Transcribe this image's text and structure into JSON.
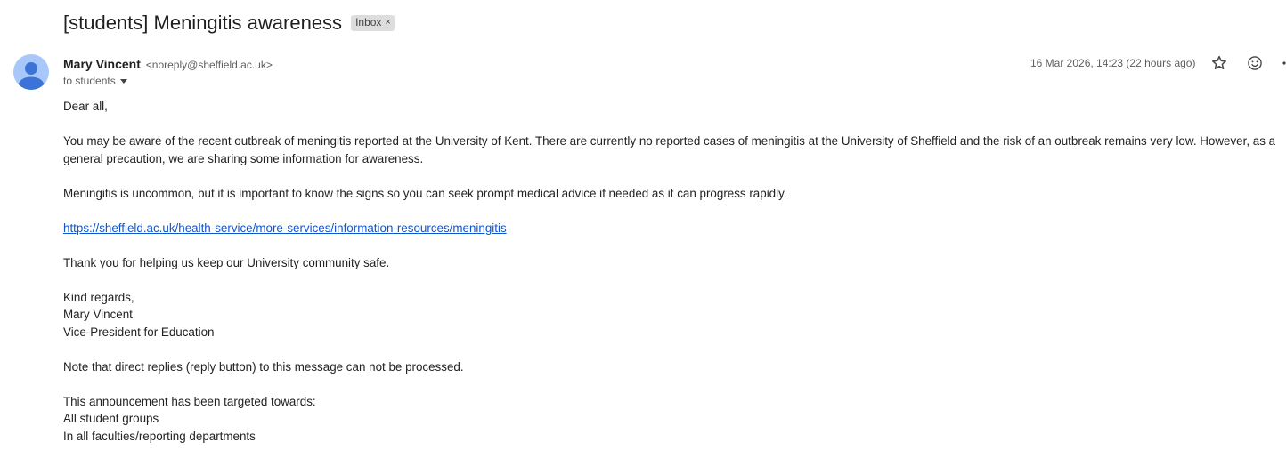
{
  "email": {
    "subject": "[students] Meningitis awareness",
    "label": "Inbox",
    "label_remove": "×",
    "sender_name": "Mary Vincent",
    "sender_email": "<noreply@sheffield.ac.uk>",
    "recipient": "to students",
    "date": "16 Mar 2026, 14:23 (22 hours ago)",
    "body": {
      "greeting": "Dear all,",
      "para1": "You may be aware of the recent outbreak of meningitis reported at the University of Kent. There are currently no reported cases of meningitis at the University of Sheffield and the risk of an outbreak remains very low. However, as a general precaution, we are sharing some information for awareness.",
      "para2": "Meningitis is uncommon, but it is important to know the signs so you can seek prompt medical advice if needed as it can progress rapidly.",
      "link": "https://sheffield.ac.uk/health-service/more-services/information-resources/meningitis",
      "para3": "Thank you for helping us keep our University community safe.",
      "signoff": "Kind regards,",
      "sig_name": "Mary Vincent",
      "sig_title": "Vice-President for Education",
      "note": "Note that direct replies (reply button) to this message can not be processed.",
      "targeted_heading": "This announcement has been targeted towards:",
      "targeted_groups": "All student groups",
      "targeted_departments": "In all faculties/reporting departments"
    }
  },
  "icons": {
    "avatar": "default-person-avatar",
    "star": "star-outline-icon",
    "emoji": "emoji-react-icon",
    "more": "more-vert-icon"
  },
  "colors": {
    "link": "#1155cc",
    "avatar_bg": "#a8c7fa",
    "avatar_fg": "#3b73d6",
    "chip_bg": "#dddddd"
  }
}
